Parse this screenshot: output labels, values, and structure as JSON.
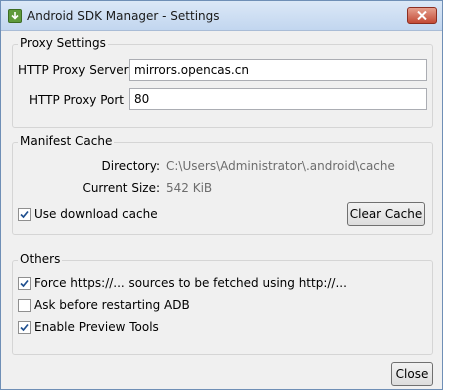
{
  "window": {
    "title": "Android SDK Manager - Settings",
    "app_icon": "android-download-icon",
    "close_icon": "close-icon"
  },
  "proxy": {
    "legend": "Proxy Settings",
    "server_label": "HTTP Proxy Server",
    "server_value": "mirrors.opencas.cn",
    "port_label": "HTTP Proxy Port",
    "port_value": "80"
  },
  "manifest": {
    "legend": "Manifest Cache",
    "directory_label": "Directory:",
    "directory_value": "C:\\Users\\Administrator\\.android\\cache",
    "size_label": "Current Size:",
    "size_value": "542 KiB",
    "use_cache_label": "Use download cache",
    "use_cache_checked": true,
    "clear_cache_label": "Clear Cache"
  },
  "others": {
    "legend": "Others",
    "options": [
      {
        "label": "Force https://... sources to be fetched using http://...",
        "checked": true
      },
      {
        "label": "Ask before restarting ADB",
        "checked": false
      },
      {
        "label": "Enable Preview Tools",
        "checked": true
      }
    ]
  },
  "footer": {
    "close_label": "Close"
  }
}
